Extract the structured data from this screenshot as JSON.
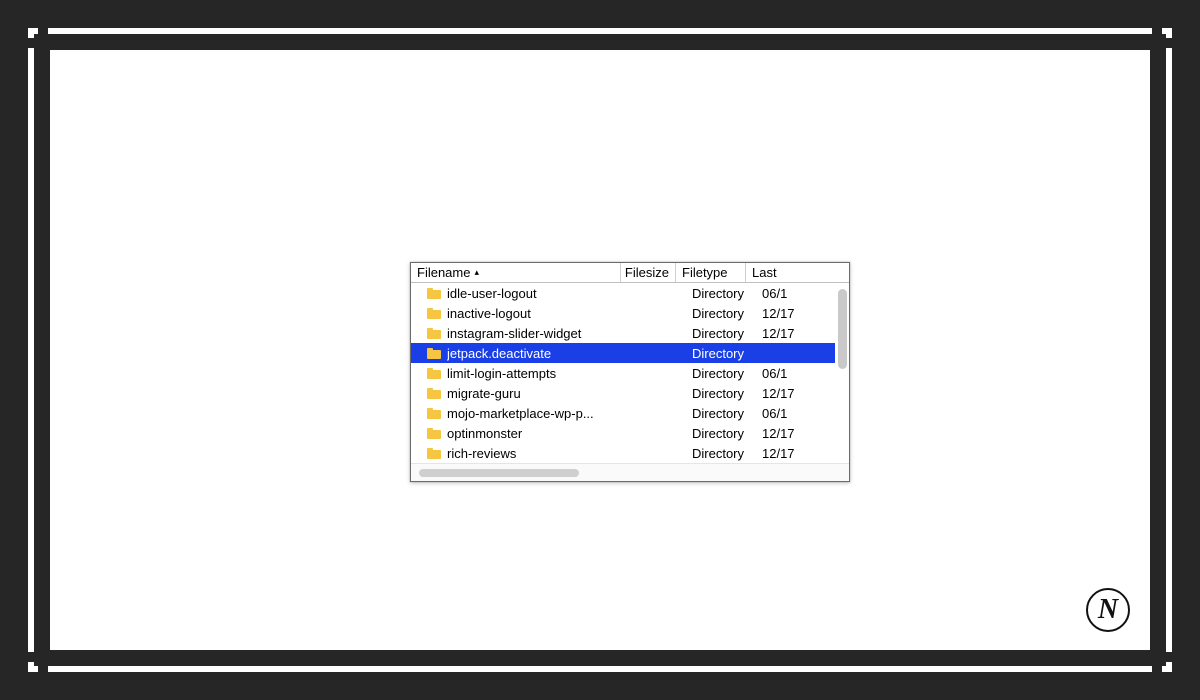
{
  "logo": {
    "letter": "N"
  },
  "fileList": {
    "headers": {
      "filename": "Filename",
      "filesize": "Filesize",
      "filetype": "Filetype",
      "last": "Last"
    },
    "sortIndicator": "▴",
    "rows": [
      {
        "name": "idle-user-logout",
        "size": "",
        "type": "Directory",
        "last": "06/1",
        "selected": false
      },
      {
        "name": "inactive-logout",
        "size": "",
        "type": "Directory",
        "last": "12/17",
        "selected": false
      },
      {
        "name": "instagram-slider-widget",
        "size": "",
        "type": "Directory",
        "last": "12/17",
        "selected": false
      },
      {
        "name": "jetpack.deactivate",
        "size": "",
        "type": "Directory",
        "last": "",
        "selected": true
      },
      {
        "name": "limit-login-attempts",
        "size": "",
        "type": "Directory",
        "last": "06/1",
        "selected": false
      },
      {
        "name": "migrate-guru",
        "size": "",
        "type": "Directory",
        "last": "12/17",
        "selected": false
      },
      {
        "name": "mojo-marketplace-wp-p...",
        "size": "",
        "type": "Directory",
        "last": "06/1",
        "selected": false
      },
      {
        "name": "optinmonster",
        "size": "",
        "type": "Directory",
        "last": "12/17",
        "selected": false
      },
      {
        "name": "rich-reviews",
        "size": "",
        "type": "Directory",
        "last": "12/17",
        "selected": false
      }
    ]
  }
}
